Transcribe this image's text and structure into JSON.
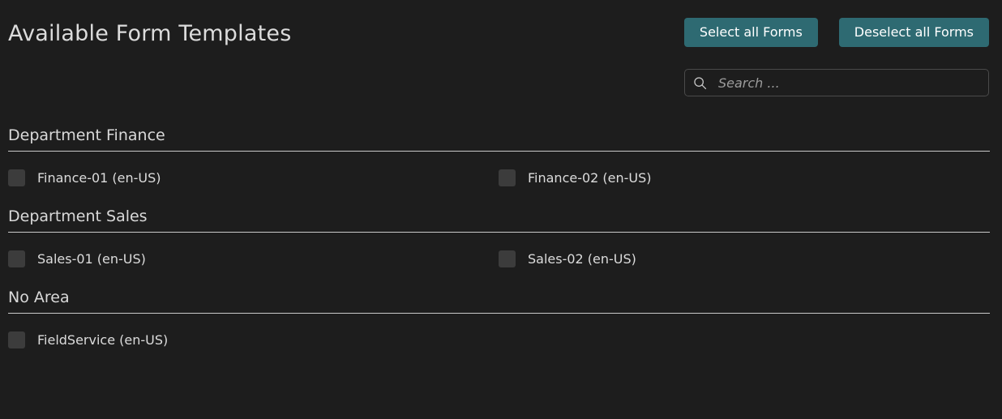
{
  "header": {
    "title": "Available Form Templates",
    "select_all_label": "Select all Forms",
    "deselect_all_label": "Deselect all Forms"
  },
  "search": {
    "icon": "search-icon",
    "placeholder": "Search ...",
    "value": ""
  },
  "colors": {
    "background": "#1d1d1d",
    "accent_button": "#2e6a72",
    "button_text": "#ffffff",
    "text": "#dcdcdc",
    "checkbox_fill": "#3c3c3c",
    "separator": "#c9c9c9",
    "input_border": "#4a4a4a",
    "placeholder_text": "#9b9b9b"
  },
  "sections": [
    {
      "title": "Department Finance",
      "items": [
        {
          "label": "Finance-01 (en-US)",
          "checked": false
        },
        {
          "label": "Finance-02 (en-US)",
          "checked": false
        }
      ]
    },
    {
      "title": "Department Sales",
      "items": [
        {
          "label": "Sales-01 (en-US)",
          "checked": false
        },
        {
          "label": "Sales-02 (en-US)",
          "checked": false
        }
      ]
    },
    {
      "title": "No Area",
      "items": [
        {
          "label": "FieldService (en-US)",
          "checked": false
        }
      ]
    }
  ]
}
